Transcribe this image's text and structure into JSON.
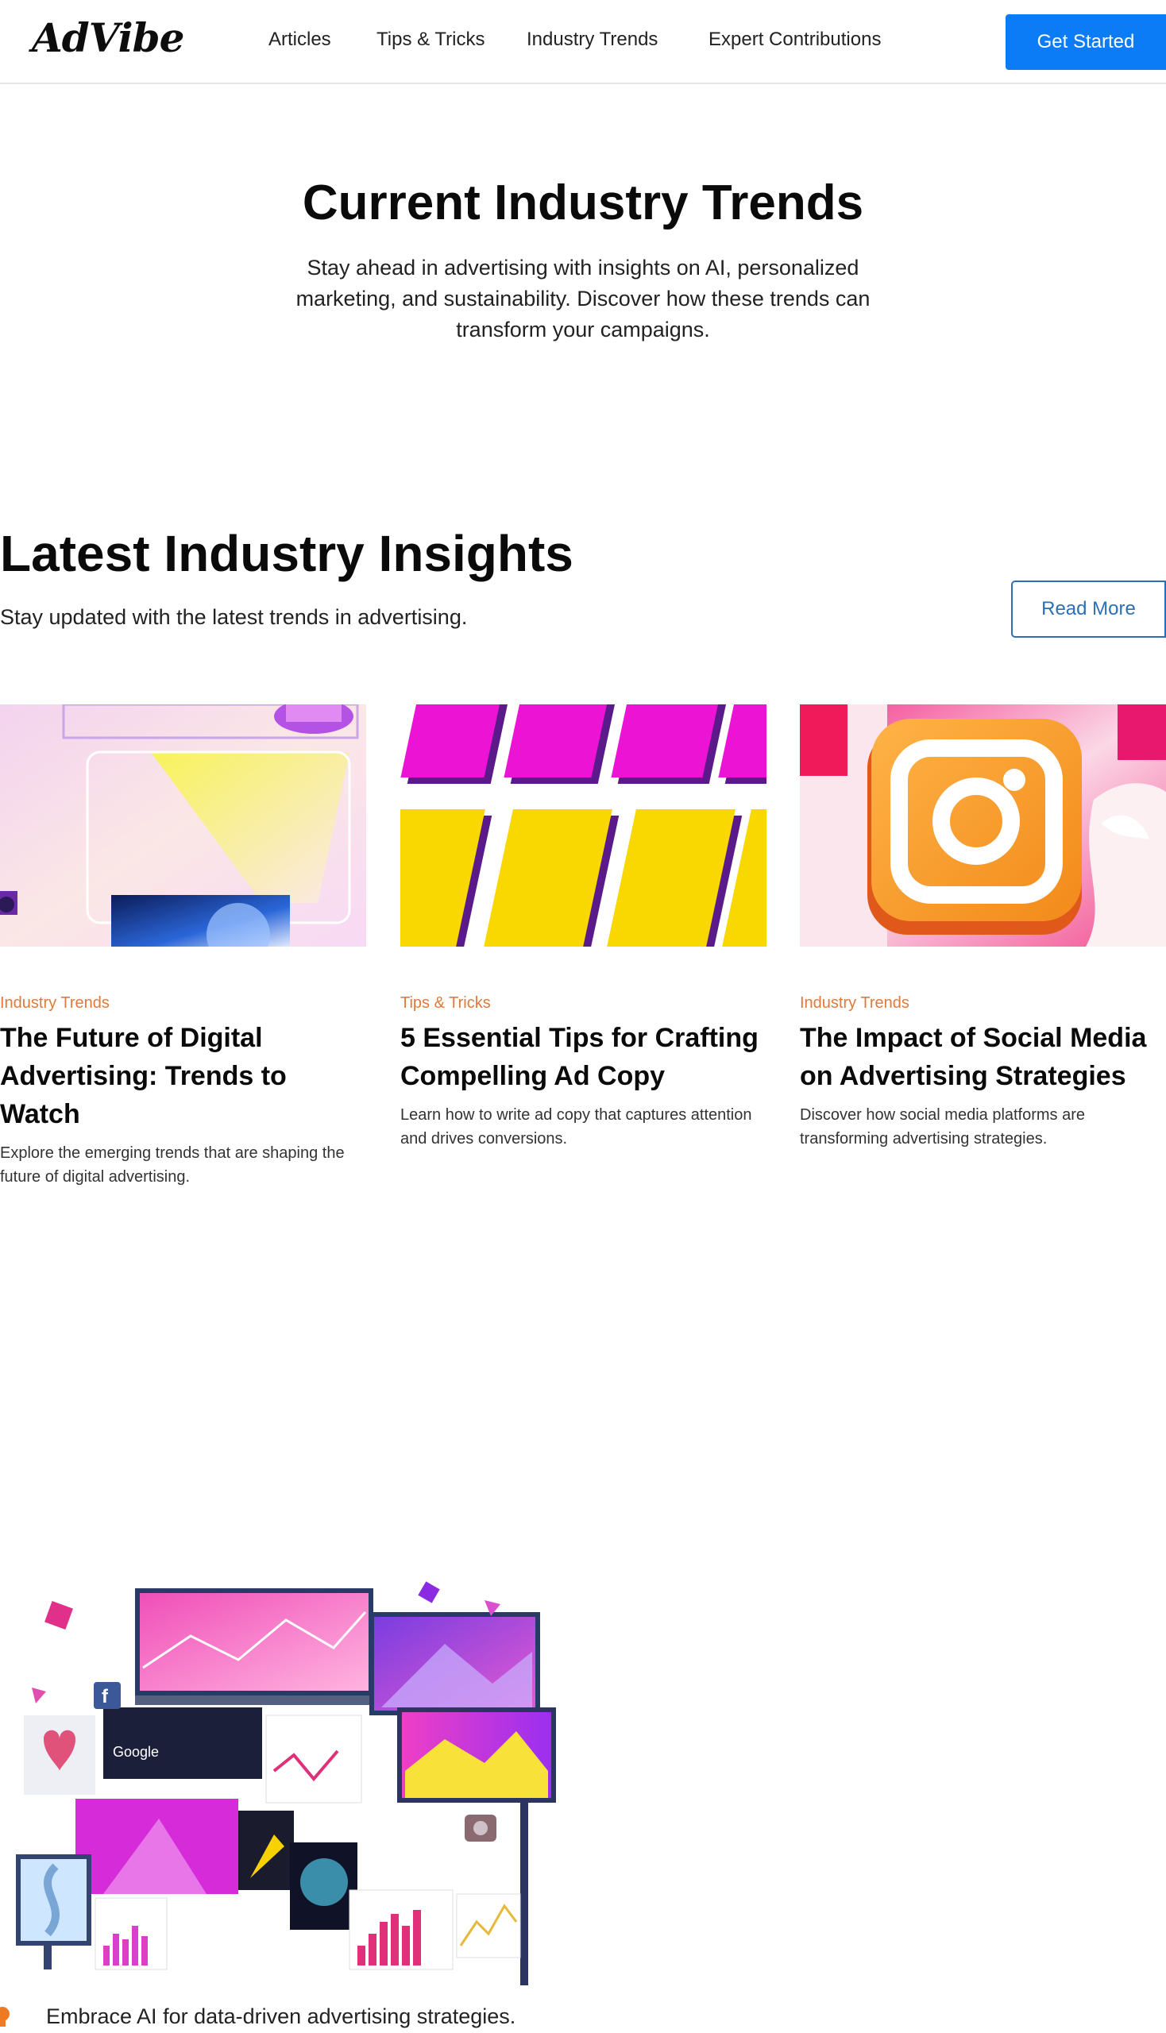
{
  "header": {
    "logo": "AdVibe",
    "nav": [
      "Articles",
      "Tips & Tricks",
      "Industry Trends",
      "Expert Contributions"
    ],
    "cta_label": "Get Started"
  },
  "hero": {
    "title": "Current Industry Trends",
    "subtitle": "Stay ahead in advertising with insights on AI, personalized marketing, and sustainability. Discover how these trends can transform your campaigns."
  },
  "insights": {
    "title": "Latest Industry Insights",
    "subtitle": "Stay updated with the latest trends in advertising.",
    "read_more_label": "Read More",
    "cards": [
      {
        "category": "Industry Trends",
        "title": "The Future of Digital Advertising: Trends to Watch",
        "description": "Explore the emerging trends that are shaping the future of digital advertising."
      },
      {
        "category": "Tips & Tricks",
        "title": "5 Essential Tips for Crafting Compelling Ad Copy",
        "description": "Learn how to write ad copy that captures attention and drives conversions."
      },
      {
        "category": "Industry Trends",
        "title": "The Impact of Social Media on Advertising Strategies",
        "description": "Discover how social media platforms are transforming advertising strategies."
      }
    ]
  },
  "feature": {
    "bullet_text": "Embrace AI for data-driven advertising strategies."
  },
  "colors": {
    "accent": "#0b7cf5",
    "category": "#e0793a",
    "outline_button": "#2c6fb5"
  }
}
